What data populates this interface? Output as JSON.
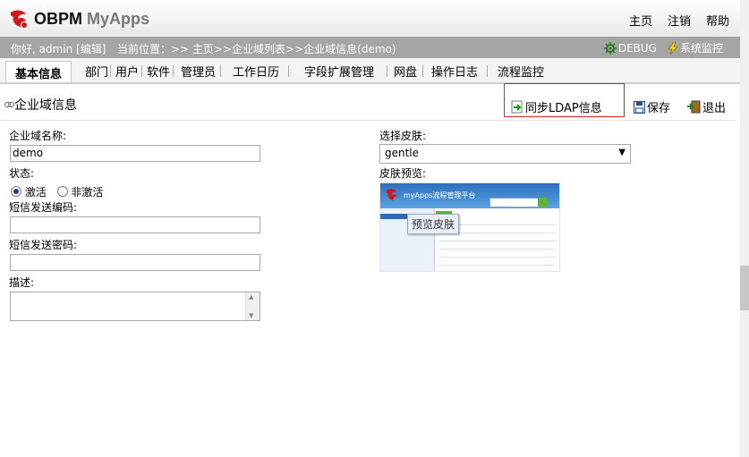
{
  "app": {
    "logo_title": "OBPM",
    "logo_sub": "MyApps"
  },
  "topnav": {
    "home": "主页",
    "logout": "注销",
    "help": "帮助"
  },
  "infobar": {
    "greeting": "你好, admin [编辑]",
    "breadcrumb": "当前位置：>> 主页>>企业域列表>>企业域信息(demo)",
    "debug": "DEBUG",
    "monitor": "系统监控"
  },
  "tabs": [
    "基本信息",
    "部门",
    "用户",
    "软件",
    "管理员",
    "工作日历",
    "字段扩展管理",
    "网盘",
    "操作日志",
    "流程监控"
  ],
  "section": {
    "title": "企业域信息"
  },
  "toolbar": {
    "sync_ldap": "同步LDAP信息",
    "save": "保存",
    "exit": "退出"
  },
  "form": {
    "domain_name_label": "企业域名称:",
    "domain_name_value": "demo",
    "status_label": "状态:",
    "status_active": "激活",
    "status_inactive": "非激活",
    "status_selected": "激活",
    "sms_code_label": "短信发送编码:",
    "sms_code_value": "",
    "sms_password_label": "短信发送密码:",
    "sms_password_value": "",
    "description_label": "描述:",
    "description_value": "",
    "skin_label": "选择皮肤:",
    "skin_value": "gentle",
    "skin_preview_label": "皮肤预览:",
    "preview_tooltip": "预览皮肤",
    "preview_app_title": "myApps流程管理平台"
  },
  "colors": {
    "infobar_bg": "#a5a5a5",
    "highlight_border": "#dd2222"
  }
}
